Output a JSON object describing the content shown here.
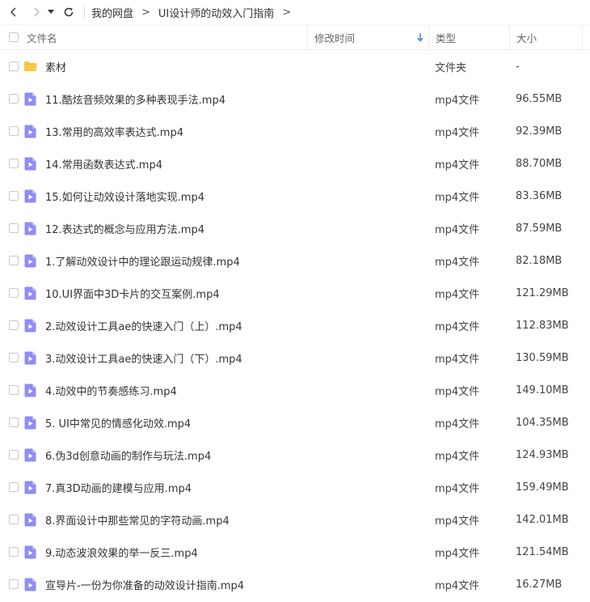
{
  "nav": {
    "breadcrumbs": [
      "我的网盘",
      "UI设计师的动效入门指南"
    ]
  },
  "header": {
    "name": "文件名",
    "time": "修改时间",
    "type": "类型",
    "size": "大小"
  },
  "rows": [
    {
      "name": "素材",
      "type": "文件夹",
      "size": "-",
      "icon": "folder-icon"
    },
    {
      "name": "11.酷炫音频效果的多种表现手法.mp4",
      "type": "mp4文件",
      "size": "96.55MB",
      "icon": "video-file-icon"
    },
    {
      "name": "13.常用的高效率表达式.mp4",
      "type": "mp4文件",
      "size": "92.39MB",
      "icon": "video-file-icon"
    },
    {
      "name": "14.常用函数表达式.mp4",
      "type": "mp4文件",
      "size": "88.70MB",
      "icon": "video-file-icon"
    },
    {
      "name": "15.如何让动效设计落地实现.mp4",
      "type": "mp4文件",
      "size": "83.36MB",
      "icon": "video-file-icon"
    },
    {
      "name": "12.表达式的概念与应用方法.mp4",
      "type": "mp4文件",
      "size": "87.59MB",
      "icon": "video-file-icon"
    },
    {
      "name": "1.了解动效设计中的理论跟运动规律.mp4",
      "type": "mp4文件",
      "size": "82.18MB",
      "icon": "video-file-icon"
    },
    {
      "name": "10.UI界面中3D卡片的交互案例.mp4",
      "type": "mp4文件",
      "size": "121.29MB",
      "icon": "video-file-icon"
    },
    {
      "name": "2.动效设计工具ae的快速入门（上）.mp4",
      "type": "mp4文件",
      "size": "112.83MB",
      "icon": "video-file-icon"
    },
    {
      "name": "3.动效设计工具ae的快速入门（下）.mp4",
      "type": "mp4文件",
      "size": "130.59MB",
      "icon": "video-file-icon"
    },
    {
      "name": "4.动效中的节奏感练习.mp4",
      "type": "mp4文件",
      "size": "149.10MB",
      "icon": "video-file-icon"
    },
    {
      "name": "5. UI中常见的情感化动效.mp4",
      "type": "mp4文件",
      "size": "104.35MB",
      "icon": "video-file-icon"
    },
    {
      "name": "6.伪3d创意动画的制作与玩法.mp4",
      "type": "mp4文件",
      "size": "124.93MB",
      "icon": "video-file-icon"
    },
    {
      "name": "7.真3D动画的建模与应用.mp4",
      "type": "mp4文件",
      "size": "159.49MB",
      "icon": "video-file-icon"
    },
    {
      "name": "8.界面设计中那些常见的字符动画.mp4",
      "type": "mp4文件",
      "size": "142.01MB",
      "icon": "video-file-icon"
    },
    {
      "name": "9.动态波浪效果的举一反三.mp4",
      "type": "mp4文件",
      "size": "121.54MB",
      "icon": "video-file-icon"
    },
    {
      "name": "宣导片-一份为你准备的动效设计指南.mp4",
      "type": "mp4文件",
      "size": "16.27MB",
      "icon": "video-file-icon"
    }
  ],
  "colors": {
    "folder": "#f7c948",
    "video": "#8f8df2",
    "sort_arrow": "#2f80ed"
  }
}
